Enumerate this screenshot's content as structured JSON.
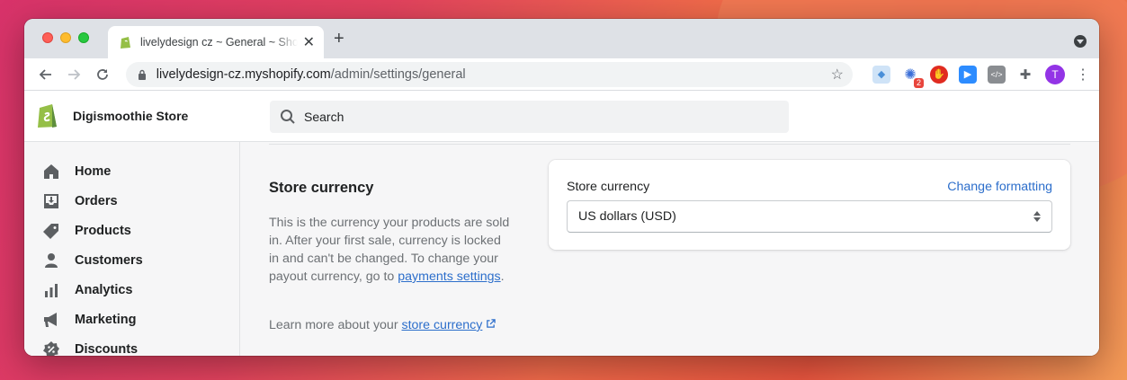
{
  "browser": {
    "tab_title": "livelydesign cz ~ General ~ Shopify",
    "url_host": "livelydesign-cz.myshopify.com",
    "url_path": "/admin/settings/general",
    "extension_badge": "2",
    "profile_initial": "T"
  },
  "header": {
    "store_name": "Digismoothie Store",
    "search_placeholder": "Search"
  },
  "sidebar": {
    "items": [
      {
        "label": "Home",
        "icon": "home-icon"
      },
      {
        "label": "Orders",
        "icon": "orders-icon"
      },
      {
        "label": "Products",
        "icon": "tag-icon"
      },
      {
        "label": "Customers",
        "icon": "person-icon"
      },
      {
        "label": "Analytics",
        "icon": "bar-chart-icon"
      },
      {
        "label": "Marketing",
        "icon": "megaphone-icon"
      },
      {
        "label": "Discounts",
        "icon": "discount-icon"
      }
    ]
  },
  "section": {
    "title": "Store currency",
    "description": "This is the currency your products are sold in. After your first sale, currency is locked in and can't be changed. To change your payout currency, go to ",
    "payments_link": "payments settings",
    "period": ".",
    "learn_more_text": "Learn more about your ",
    "learn_more_link": "store currency"
  },
  "card": {
    "label": "Store currency",
    "action": "Change formatting",
    "selected_currency": "US dollars (USD)"
  },
  "colors": {
    "link": "#2c6ecb",
    "shopify_green": "#95bf47",
    "avatar": "#9334e6"
  }
}
